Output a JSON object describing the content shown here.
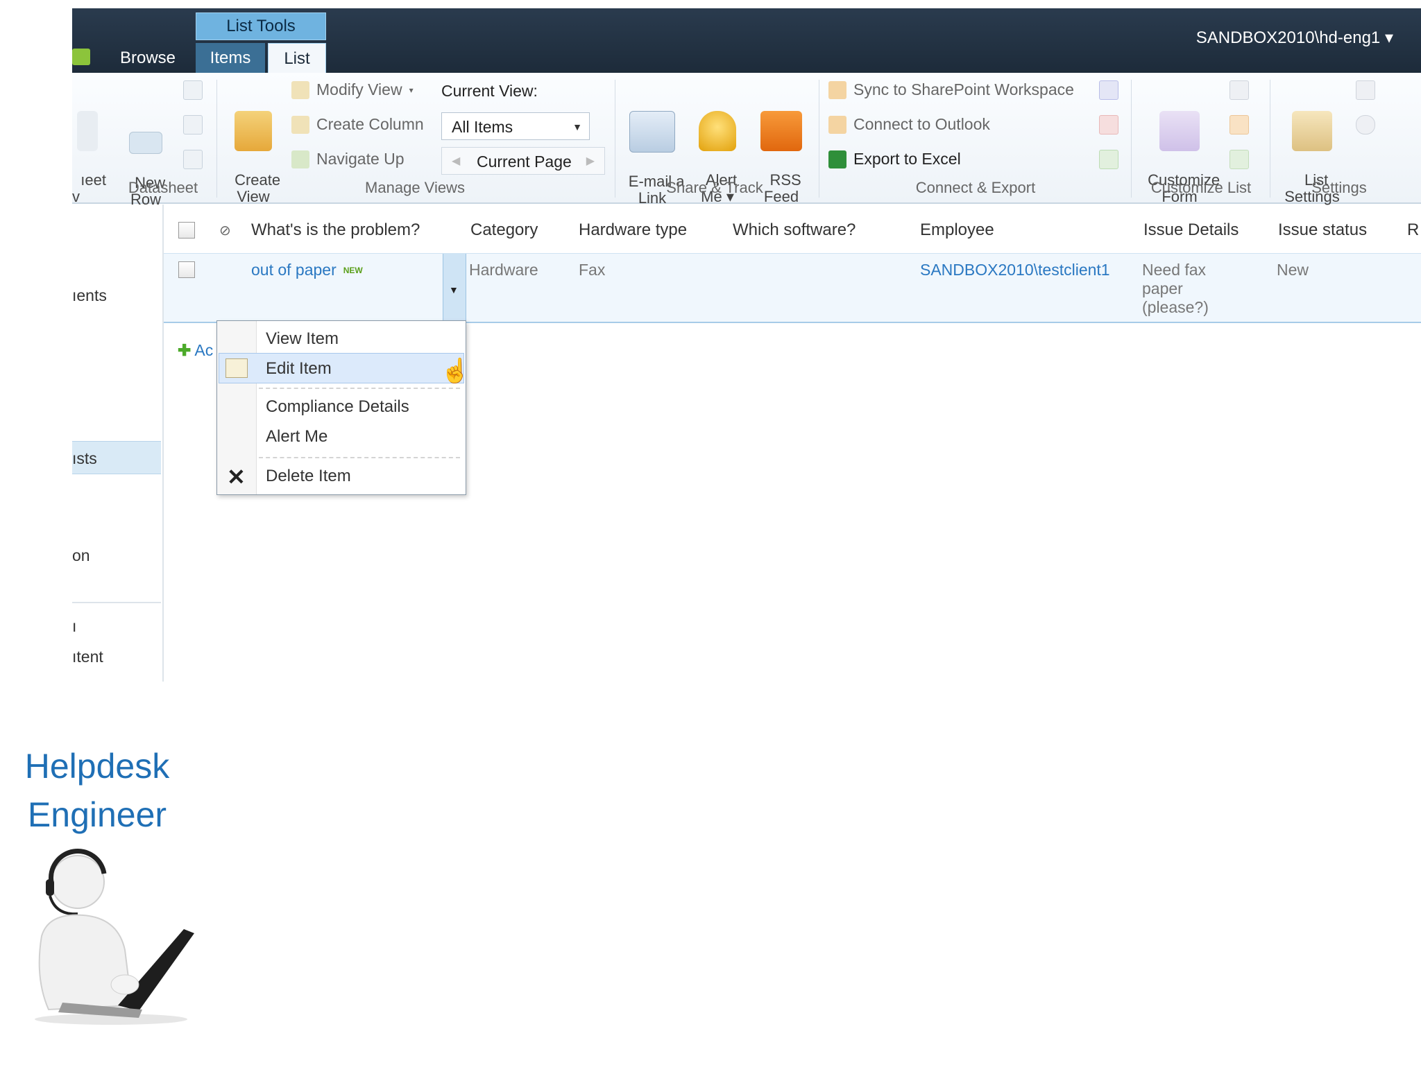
{
  "topbar": {
    "context_group": "List Tools",
    "tabs": [
      "Browse",
      "Items",
      "List"
    ],
    "user": "SANDBOX2010\\hd-eng1 ▾"
  },
  "ribbon": {
    "datasheet": {
      "partial_label": "ıeet\nv",
      "new_row": "New\nRow",
      "group": "Datasheet"
    },
    "manage_views": {
      "create_view": "Create\nView",
      "modify_view": "Modify View",
      "create_column": "Create Column",
      "navigate_up": "Navigate Up",
      "current_view_label": "Current View:",
      "current_view_value": "All Items",
      "current_page": "Current Page",
      "group": "Manage Views"
    },
    "share_track": {
      "email": "E-mail a\nLink",
      "alert": "Alert\nMe ▾",
      "rss": "RSS\nFeed",
      "group": "Share & Track"
    },
    "connect_export": {
      "sync": "Sync to SharePoint Workspace",
      "outlook": "Connect to Outlook",
      "excel": "Export to Excel",
      "group": "Connect & Export"
    },
    "customize_list": {
      "customize_form": "Customize\nForm",
      "group": "Customize List"
    },
    "settings": {
      "list_settings": "List\nSettings",
      "group": "Settings"
    }
  },
  "leftnav": {
    "items": [
      "ıents",
      "ısts",
      "on",
      "ı",
      "ıtent"
    ]
  },
  "list": {
    "columns": [
      "What's is the problem?",
      "Category",
      "Hardware type",
      "Which software?",
      "Employee",
      "Issue Details",
      "Issue status",
      "R"
    ],
    "row": {
      "title": "out of paper",
      "new_badge": "NEW",
      "category": "Hardware",
      "hardware_type": "Fax",
      "employee": "SANDBOX2010\\testclient1",
      "issue_details": "Need fax\npaper\n(please?)",
      "issue_status": "New"
    },
    "add_new": "Ac"
  },
  "context_menu": {
    "items": [
      "View Item",
      "Edit Item",
      "Compliance Details",
      "Alert Me",
      "Delete Item"
    ]
  },
  "caption": {
    "line1": "Helpdesk",
    "line2": "Engineer"
  },
  "colors": {
    "topbar": "#1d2b3a",
    "accent_tab": "#6fb3e0",
    "link": "#2a78c2",
    "caption": "#1f6fb5"
  }
}
